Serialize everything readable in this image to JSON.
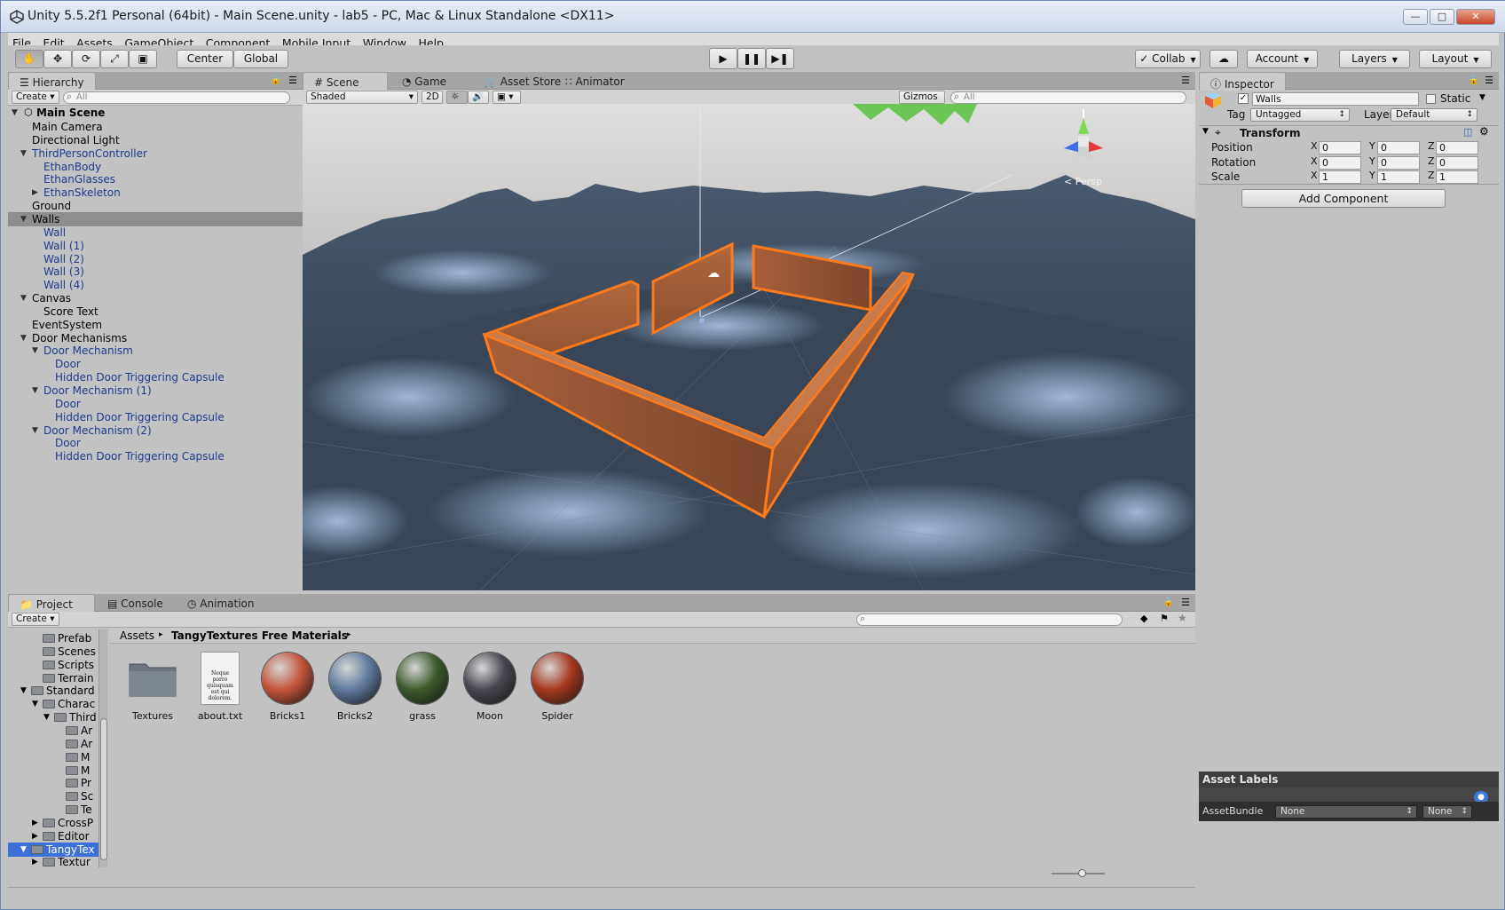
{
  "window": {
    "title": "Unity 5.5.2f1 Personal (64bit) - Main Scene.unity - lab5 - PC, Mac & Linux Standalone <DX11>"
  },
  "menu": [
    "File",
    "Edit",
    "Assets",
    "GameObject",
    "Component",
    "Mobile Input",
    "Window",
    "Help"
  ],
  "toolbar": {
    "pivot": "Center",
    "space": "Global",
    "collab": "Collab",
    "account": "Account",
    "layers": "Layers",
    "layout": "Layout"
  },
  "hierarchy": {
    "tab": "Hierarchy",
    "create": "Create",
    "search_placeholder": "All",
    "scene": "Main Scene",
    "items": [
      {
        "label": "Main Camera",
        "depth": 1,
        "arrow": "",
        "blue": false,
        "selected": false
      },
      {
        "label": "Directional Light",
        "depth": 1,
        "arrow": "",
        "blue": false,
        "selected": false
      },
      {
        "label": "ThirdPersonController",
        "depth": 1,
        "arrow": "down",
        "blue": true,
        "selected": false
      },
      {
        "label": "EthanBody",
        "depth": 2,
        "arrow": "",
        "blue": true,
        "selected": false
      },
      {
        "label": "EthanGlasses",
        "depth": 2,
        "arrow": "",
        "blue": true,
        "selected": false
      },
      {
        "label": "EthanSkeleton",
        "depth": 2,
        "arrow": "right",
        "blue": true,
        "selected": false
      },
      {
        "label": "Ground",
        "depth": 1,
        "arrow": "",
        "blue": false,
        "selected": false
      },
      {
        "label": "Walls",
        "depth": 1,
        "arrow": "down",
        "blue": false,
        "selected": true
      },
      {
        "label": "Wall",
        "depth": 2,
        "arrow": "",
        "blue": true,
        "selected": false
      },
      {
        "label": "Wall (1)",
        "depth": 2,
        "arrow": "",
        "blue": true,
        "selected": false
      },
      {
        "label": "Wall (2)",
        "depth": 2,
        "arrow": "",
        "blue": true,
        "selected": false
      },
      {
        "label": "Wall (3)",
        "depth": 2,
        "arrow": "",
        "blue": true,
        "selected": false
      },
      {
        "label": "Wall (4)",
        "depth": 2,
        "arrow": "",
        "blue": true,
        "selected": false
      },
      {
        "label": "Canvas",
        "depth": 1,
        "arrow": "down",
        "blue": false,
        "selected": false
      },
      {
        "label": "Score Text",
        "depth": 2,
        "arrow": "",
        "blue": false,
        "selected": false
      },
      {
        "label": "EventSystem",
        "depth": 1,
        "arrow": "",
        "blue": false,
        "selected": false
      },
      {
        "label": "Door Mechanisms",
        "depth": 1,
        "arrow": "down",
        "blue": false,
        "selected": false
      },
      {
        "label": "Door Mechanism",
        "depth": 2,
        "arrow": "down",
        "blue": true,
        "selected": false
      },
      {
        "label": "Door",
        "depth": 3,
        "arrow": "",
        "blue": true,
        "selected": false
      },
      {
        "label": "Hidden Door Triggering Capsule",
        "depth": 3,
        "arrow": "",
        "blue": true,
        "selected": false
      },
      {
        "label": "Door Mechanism (1)",
        "depth": 2,
        "arrow": "down",
        "blue": true,
        "selected": false
      },
      {
        "label": "Door",
        "depth": 3,
        "arrow": "",
        "blue": true,
        "selected": false
      },
      {
        "label": "Hidden Door Triggering Capsule",
        "depth": 3,
        "arrow": "",
        "blue": true,
        "selected": false
      },
      {
        "label": "Door Mechanism (2)",
        "depth": 2,
        "arrow": "down",
        "blue": true,
        "selected": false
      },
      {
        "label": "Door",
        "depth": 3,
        "arrow": "",
        "blue": true,
        "selected": false
      },
      {
        "label": "Hidden Door Triggering Capsule",
        "depth": 3,
        "arrow": "",
        "blue": true,
        "selected": false
      }
    ]
  },
  "scene_view": {
    "tabs": [
      "Scene",
      "Game",
      "Asset Store",
      "Animator"
    ],
    "shading": "Shaded",
    "mode_2d": "2D",
    "gizmos": "Gizmos",
    "search_placeholder": "All",
    "persp": "Persp"
  },
  "inspector": {
    "tab": "Inspector",
    "name": "Walls",
    "static": "Static",
    "tag_label": "Tag",
    "tag": "Untagged",
    "layer_label": "Layer",
    "layer": "Default",
    "transform": "Transform",
    "rows": [
      {
        "label": "Position",
        "x": "0",
        "y": "0",
        "z": "0"
      },
      {
        "label": "Rotation",
        "x": "0",
        "y": "0",
        "z": "0"
      },
      {
        "label": "Scale",
        "x": "1",
        "y": "1",
        "z": "1"
      }
    ],
    "add_component": "Add Component",
    "asset_labels": "Asset Labels",
    "asset_bundle_label": "AssetBundle",
    "asset_bundle": "None",
    "asset_variant": "None"
  },
  "project": {
    "tabs": [
      "Project",
      "Console",
      "Animation"
    ],
    "create": "Create",
    "breadcrumb_root": "Assets",
    "breadcrumb_current": "TangyTextures Free Materials",
    "tree": [
      {
        "label": "Prefab",
        "depth": 2,
        "arrow": "",
        "selected": false
      },
      {
        "label": "Scenes",
        "depth": 2,
        "arrow": "",
        "selected": false
      },
      {
        "label": "Scripts",
        "depth": 2,
        "arrow": "",
        "selected": false
      },
      {
        "label": "Terrain",
        "depth": 2,
        "arrow": "",
        "selected": false
      },
      {
        "label": "Standard",
        "depth": 1,
        "arrow": "down",
        "selected": false
      },
      {
        "label": "Charac",
        "depth": 2,
        "arrow": "down",
        "selected": false
      },
      {
        "label": "Third",
        "depth": 3,
        "arrow": "down",
        "selected": false
      },
      {
        "label": "Ar",
        "depth": 4,
        "arrow": "",
        "selected": false
      },
      {
        "label": "Ar",
        "depth": 4,
        "arrow": "",
        "selected": false
      },
      {
        "label": "M",
        "depth": 4,
        "arrow": "",
        "selected": false
      },
      {
        "label": "M",
        "depth": 4,
        "arrow": "",
        "selected": false
      },
      {
        "label": "Pr",
        "depth": 4,
        "arrow": "",
        "selected": false
      },
      {
        "label": "Sc",
        "depth": 4,
        "arrow": "",
        "selected": false
      },
      {
        "label": "Te",
        "depth": 4,
        "arrow": "",
        "selected": false
      },
      {
        "label": "CrossP",
        "depth": 2,
        "arrow": "right",
        "selected": false
      },
      {
        "label": "Editor",
        "depth": 2,
        "arrow": "right",
        "selected": false
      },
      {
        "label": "TangyTex",
        "depth": 1,
        "arrow": "down",
        "selected": true
      },
      {
        "label": "Textur",
        "depth": 2,
        "arrow": "right",
        "selected": false
      }
    ],
    "assets": [
      {
        "label": "Textures",
        "kind": "folder",
        "color": "#6d7681"
      },
      {
        "label": "about.txt",
        "kind": "file",
        "color": "#f2f2f2"
      },
      {
        "label": "Bricks1",
        "kind": "sphere",
        "color": "#c4553a"
      },
      {
        "label": "Bricks2",
        "kind": "sphere",
        "color": "#5f7a9c"
      },
      {
        "label": "grass",
        "kind": "sphere",
        "color": "#3c5a2c"
      },
      {
        "label": "Moon",
        "kind": "sphere",
        "color": "#474850"
      },
      {
        "label": "Spider",
        "kind": "sphere",
        "color": "#a6391e"
      }
    ],
    "about_preview": "Neque porro quisquam est qui dolorem."
  }
}
